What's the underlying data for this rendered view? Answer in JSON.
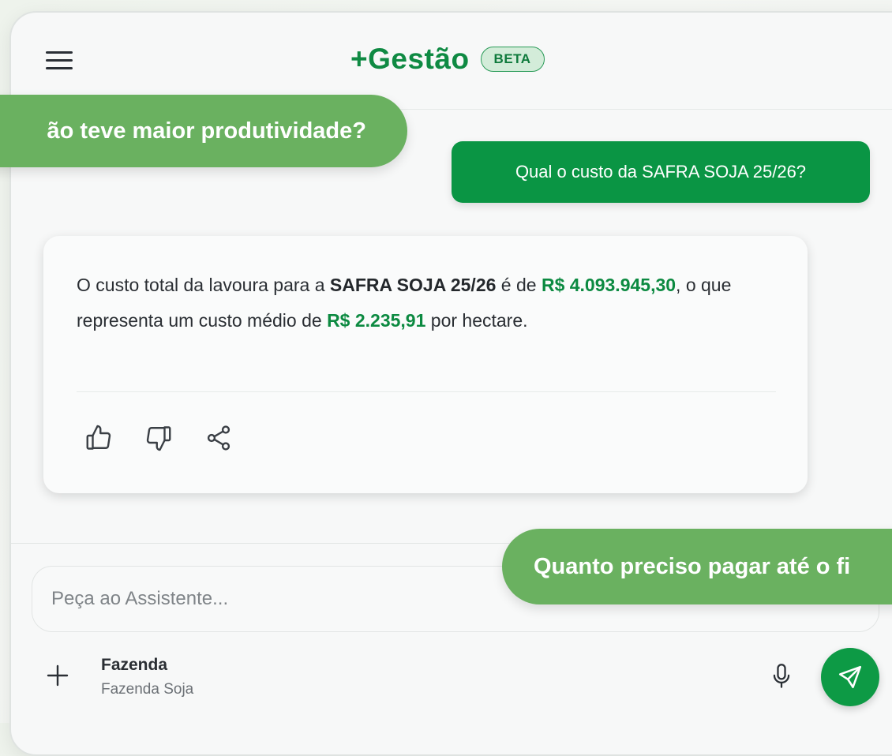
{
  "header": {
    "title": "+Gestão",
    "badge": "BETA"
  },
  "chat": {
    "user_message": "Qual o custo da SAFRA SOJA 25/26?",
    "answer": {
      "p1": "O custo total da lavoura para a ",
      "crop": "SAFRA SOJA 25/26",
      "p2": " é de ",
      "total": "R$ 4.093.945,30",
      "p3": ", o que representa um custo médio de ",
      "avg": "R$ 2.235,91",
      "p4": " por hectare."
    },
    "actions": [
      "thumbs-up-icon",
      "thumbs-down-icon",
      "share-icon"
    ]
  },
  "floating_suggestions": {
    "left": "ão teve maior produtividade?",
    "right": "Quanto preciso pagar até o fi"
  },
  "composer": {
    "placeholder": "Peça ao Assistente...",
    "context_label": "Fazenda",
    "context_value": "Fazenda Soja"
  },
  "colors": {
    "brand": "#0f8a43",
    "user_bubble": "#0a9544",
    "floating_bubble": "#6ab160",
    "send_button": "#0d9a45"
  }
}
